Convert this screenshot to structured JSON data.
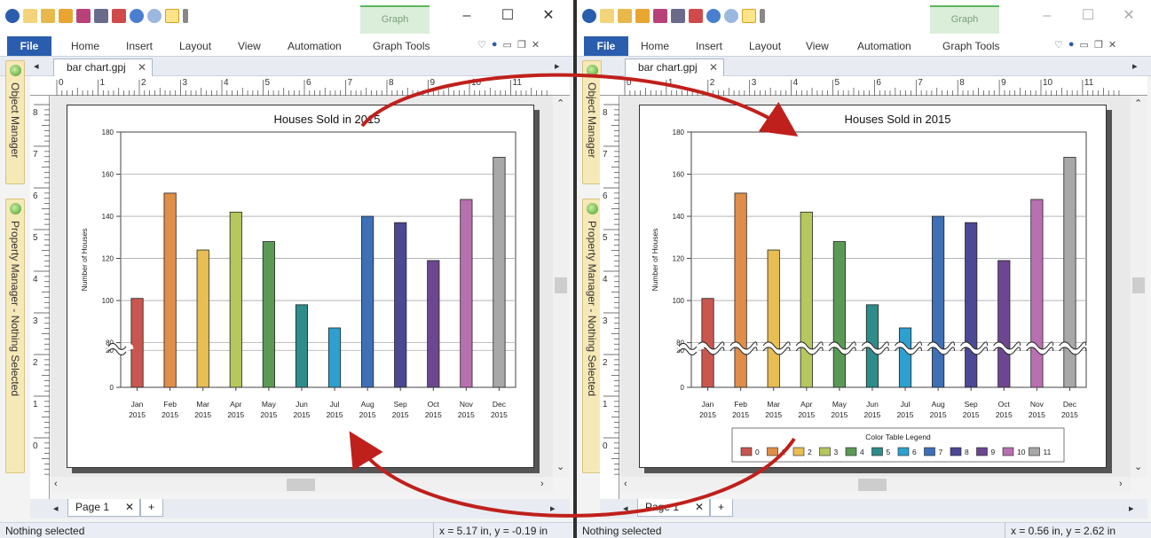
{
  "left": {
    "qat_title": "Graph",
    "ribbon_tabs": [
      "File",
      "Home",
      "Insert",
      "Layout",
      "View",
      "Automation",
      "Graph Tools"
    ],
    "doc_tab": "bar chart.gpj",
    "side_panel": {
      "object_manager": "Object Manager",
      "property_manager": "Property Manager - Nothing Selected"
    },
    "page_tab": "Page 1",
    "status_text": "Nothing selected",
    "coord_text": "x = 5.17 in, y = -0.19 in"
  },
  "right": {
    "qat_title": "Graph",
    "ribbon_tabs": [
      "File",
      "Home",
      "Insert",
      "Layout",
      "View",
      "Automation",
      "Graph Tools"
    ],
    "doc_tab": "bar chart.gpj",
    "side_panel": {
      "object_manager": "Object Manager",
      "property_manager": "Property Manager - Nothing Selected"
    },
    "page_tab": "Page 1",
    "status_text": "Nothing selected",
    "coord_text": "x = 0.56 in, y = 2.62 in"
  },
  "ruler_numbers_h": [
    "0",
    "1",
    "2",
    "3",
    "4",
    "5",
    "6",
    "7",
    "8",
    "9",
    "10",
    "11"
  ],
  "ruler_numbers_v": [
    "8",
    "7",
    "6",
    "5",
    "4",
    "3",
    "2",
    "1",
    "0"
  ],
  "chart_data": [
    {
      "type": "bar",
      "title": "Houses Sold in 2015",
      "ylabel": "Number of Houses",
      "xlabel": "",
      "categories": [
        "Jan\n2015",
        "Feb\n2015",
        "Mar\n2015",
        "Apr\n2015",
        "May\n2015",
        "Jun\n2015",
        "Jul\n2015",
        "Aug\n2015",
        "Sep\n2015",
        "Oct\n2015",
        "Nov\n2015",
        "Dec\n2015"
      ],
      "values": [
        101,
        151,
        124,
        142,
        128,
        98,
        87,
        140,
        137,
        119,
        148,
        168
      ],
      "yticks": [
        0,
        20,
        80,
        100,
        120,
        140,
        160,
        180
      ],
      "axis_break": [
        20,
        80
      ],
      "break_style": "axis only",
      "grid": true,
      "colors": [
        "#c9574f",
        "#e08e48",
        "#e8be52",
        "#b5c75d",
        "#5a9a55",
        "#2e8c8b",
        "#2ea0cf",
        "#3d70b7",
        "#4b4896",
        "#6c4790",
        "#b870b0",
        "#a8a8a8"
      ]
    },
    {
      "type": "bar",
      "title": "Houses Sold in 2015",
      "ylabel": "Number of Houses",
      "xlabel": "",
      "categories": [
        "Jan\n2015",
        "Feb\n2015",
        "Mar\n2015",
        "Apr\n2015",
        "May\n2015",
        "Jun\n2015",
        "Jul\n2015",
        "Aug\n2015",
        "Sep\n2015",
        "Oct\n2015",
        "Nov\n2015",
        "Dec\n2015"
      ],
      "values": [
        101,
        151,
        124,
        142,
        128,
        98,
        87,
        140,
        137,
        119,
        148,
        168
      ],
      "yticks": [
        0,
        20,
        80,
        100,
        120,
        140,
        160,
        180
      ],
      "axis_break": [
        20,
        80
      ],
      "break_style": "axis and bars",
      "grid": true,
      "legend": {
        "title": "Color Table Legend",
        "entries": [
          "0",
          "1",
          "2",
          "3",
          "4",
          "5",
          "6",
          "7",
          "8",
          "9",
          "10",
          "11"
        ],
        "placement": "bottom-center"
      },
      "colors": [
        "#c9574f",
        "#e08e48",
        "#e8be52",
        "#b5c75d",
        "#5a9a55",
        "#2e8c8b",
        "#2ea0cf",
        "#3d70b7",
        "#4b4896",
        "#6c4790",
        "#b870b0",
        "#a8a8a8"
      ]
    }
  ],
  "annotation": {
    "arrow_color": "#c0201c"
  }
}
